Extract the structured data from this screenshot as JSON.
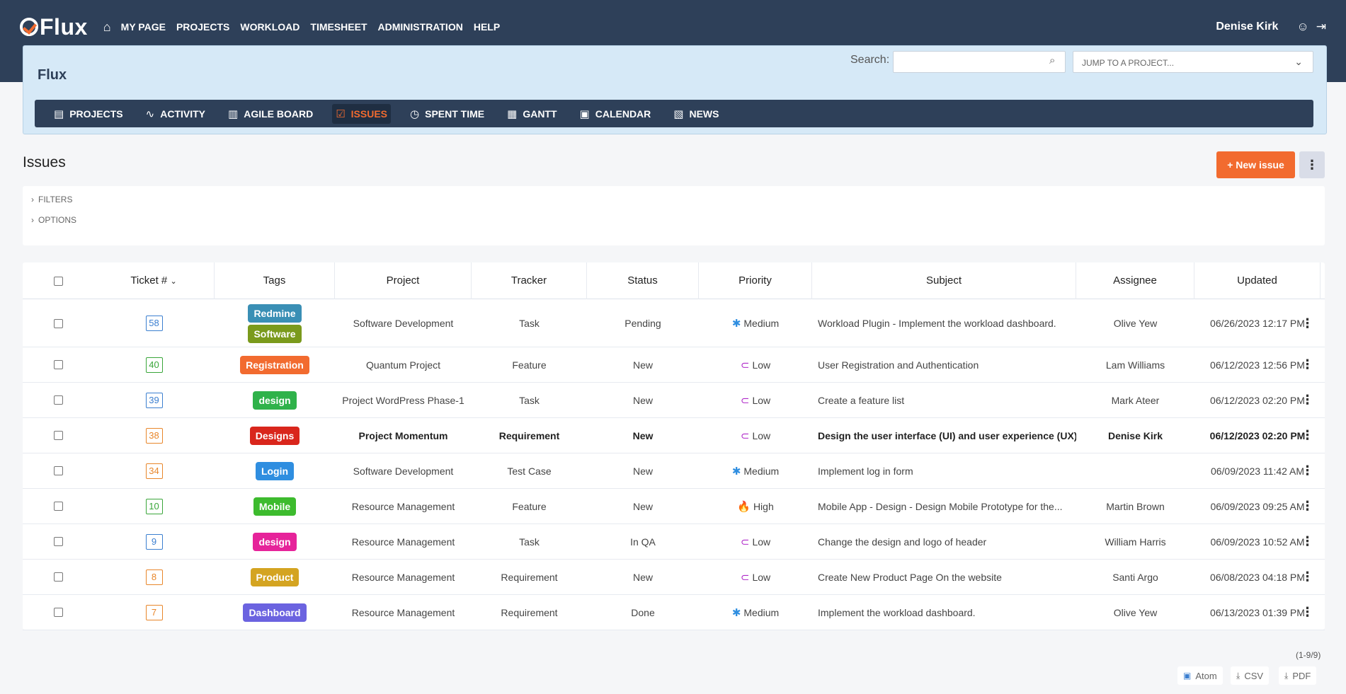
{
  "app": {
    "logo": "Flux",
    "nav": [
      "MY PAGE",
      "PROJECTS",
      "WORKLOAD",
      "TIMESHEET",
      "ADMINISTRATION",
      "HELP"
    ],
    "user_name": "Denise Kirk"
  },
  "project": {
    "title": "Flux",
    "search_label": "Search:",
    "search_value": "",
    "jump_placeholder": "JUMP TO A PROJECT...",
    "tabs": [
      {
        "label": "PROJECTS",
        "icon": "projects-icon",
        "active": false
      },
      {
        "label": "ACTIVITY",
        "icon": "activity-icon",
        "active": false
      },
      {
        "label": "AGILE BOARD",
        "icon": "agile-board-icon",
        "active": false
      },
      {
        "label": "ISSUES",
        "icon": "issues-icon",
        "active": true
      },
      {
        "label": "SPENT TIME",
        "icon": "spent-time-icon",
        "active": false
      },
      {
        "label": "GANTT",
        "icon": "gantt-icon",
        "active": false
      },
      {
        "label": "CALENDAR",
        "icon": "calendar-icon",
        "active": false
      },
      {
        "label": "NEWS",
        "icon": "news-icon",
        "active": false
      }
    ]
  },
  "page": {
    "title": "Issues",
    "new_issue_label": "+ New issue",
    "filters_label": "FILTERS",
    "options_label": "OPTIONS",
    "pagination": "(1-9/9)",
    "exports": [
      "Atom",
      "CSV",
      "PDF"
    ]
  },
  "table": {
    "columns": [
      "Ticket #",
      "Tags",
      "Project",
      "Tracker",
      "Status",
      "Priority",
      "Subject",
      "Assignee",
      "Updated"
    ],
    "rows": [
      {
        "ticket": "58",
        "ticket_color": "#3b7fd0",
        "tags": [
          {
            "label": "Redmine",
            "color": "#3a8fb5"
          },
          {
            "label": "Software",
            "color": "#7a9a1c"
          }
        ],
        "project": "Software Development",
        "tracker": "Task",
        "status": "Pending",
        "priority": "Medium",
        "subject": "Workload Plugin - Implement the workload dashboard.",
        "assignee": "Olive Yew",
        "updated": "06/26/2023 12:17 PM",
        "bold": false
      },
      {
        "ticket": "40",
        "ticket_color": "#3aa63a",
        "tags": [
          {
            "label": "Registration",
            "color": "#f26b2f"
          }
        ],
        "project": "Quantum Project",
        "tracker": "Feature",
        "status": "New",
        "priority": "Low",
        "subject": "User Registration and Authentication",
        "assignee": "Lam Williams",
        "updated": "06/12/2023 12:56 PM",
        "bold": false
      },
      {
        "ticket": "39",
        "ticket_color": "#3b7fd0",
        "tags": [
          {
            "label": "design",
            "color": "#2fb24a"
          }
        ],
        "project": "Project WordPress Phase-1",
        "tracker": "Task",
        "status": "New",
        "priority": "Low",
        "subject": "Create a feature list",
        "assignee": "Mark Ateer",
        "updated": "06/12/2023 02:20 PM",
        "bold": false
      },
      {
        "ticket": "38",
        "ticket_color": "#e8862a",
        "tags": [
          {
            "label": "Designs",
            "color": "#d9261c"
          }
        ],
        "project": "Project Momentum",
        "tracker": "Requirement",
        "status": "New",
        "priority": "Low",
        "subject": "Design the user interface (UI) and user experience (UX)",
        "assignee": "Denise Kirk",
        "updated": "06/12/2023 02:20 PM",
        "bold": true
      },
      {
        "ticket": "34",
        "ticket_color": "#e8862a",
        "tags": [
          {
            "label": "Login",
            "color": "#2f8ee0"
          }
        ],
        "project": "Software Development",
        "tracker": "Test Case",
        "status": "New",
        "priority": "Medium",
        "subject": "Implement log in form",
        "assignee": "",
        "updated": "06/09/2023 11:42 AM",
        "bold": false
      },
      {
        "ticket": "10",
        "ticket_color": "#3aa63a",
        "tags": [
          {
            "label": "Mobile",
            "color": "#3dbb2e"
          }
        ],
        "project": "Resource Management",
        "tracker": "Feature",
        "status": "New",
        "priority": "High",
        "subject": "Mobile App - Design - Design Mobile Prototype for the...",
        "assignee": "Martin Brown",
        "updated": "06/09/2023 09:25 AM",
        "bold": false
      },
      {
        "ticket": "9",
        "ticket_color": "#3b7fd0",
        "tags": [
          {
            "label": "design",
            "color": "#e6239a"
          }
        ],
        "project": "Resource Management",
        "tracker": "Task",
        "status": "In QA",
        "priority": "Low",
        "subject": "Change the design and logo of header",
        "assignee": "William Harris",
        "updated": "06/09/2023 10:52 AM",
        "bold": false
      },
      {
        "ticket": "8",
        "ticket_color": "#e8862a",
        "tags": [
          {
            "label": "Product",
            "color": "#d4a421"
          }
        ],
        "project": "Resource Management",
        "tracker": "Requirement",
        "status": "New",
        "priority": "Low",
        "subject": "Create New Product Page On the website",
        "assignee": "Santi Argo",
        "updated": "06/08/2023 04:18 PM",
        "bold": false
      },
      {
        "ticket": "7",
        "ticket_color": "#e8862a",
        "tags": [
          {
            "label": "Dashboard",
            "color": "#6b63e0"
          }
        ],
        "project": "Resource Management",
        "tracker": "Requirement",
        "status": "Done",
        "priority": "Medium",
        "subject": "Implement the workload dashboard.",
        "assignee": "Olive Yew",
        "updated": "06/13/2023 01:39 PM",
        "bold": false
      }
    ]
  },
  "priority_icons": {
    "Medium": {
      "glyph": "✱",
      "color": "#2f8ee0",
      "icon": "snowflake-icon"
    },
    "Low": {
      "glyph": "⊂",
      "color": "#b02ac9",
      "icon": "low-priority-icon"
    },
    "High": {
      "glyph": "🔥",
      "color": "#e84a2a",
      "icon": "flame-icon"
    }
  }
}
